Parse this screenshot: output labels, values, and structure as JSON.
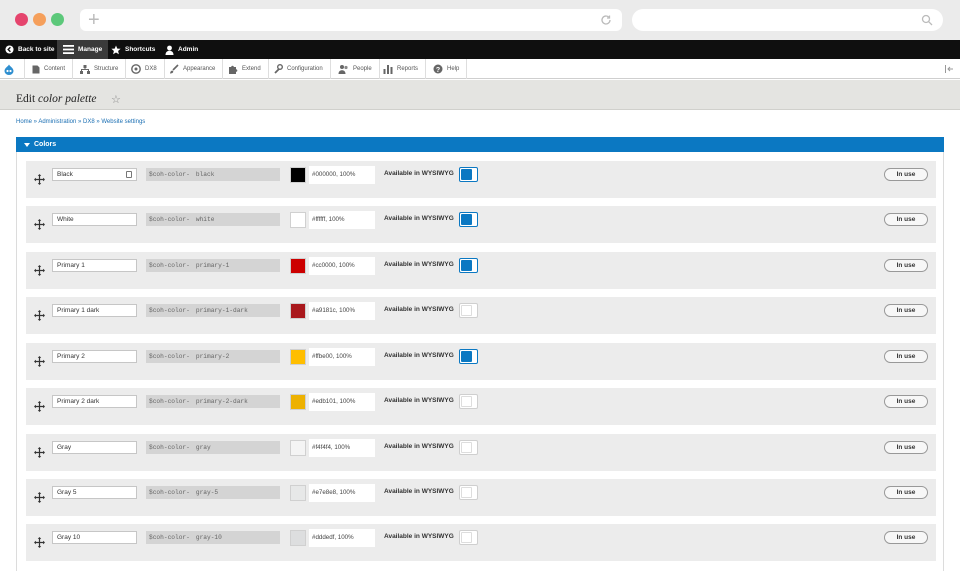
{
  "toolbar": {
    "back_to_site": "Back to site",
    "manage": "Manage",
    "shortcuts": "Shortcuts",
    "admin": "Admin"
  },
  "tray": {
    "items": [
      "Content",
      "Structure",
      "DX8",
      "Appearance",
      "Extend",
      "Configuration",
      "People",
      "Reports",
      "Help"
    ]
  },
  "page": {
    "title_prefix": "Edit",
    "title_italic": "color palette",
    "breadcrumb": "Home » Administration » DX8 » Website settings"
  },
  "colors": {
    "legend": "Colors",
    "prefix": "$coh-color-",
    "wysiwyg_label": "Available in WYSIWYG",
    "in_use_label": "In use",
    "rows": [
      {
        "name": "Black",
        "var": "black",
        "hex": "#000000, 100%",
        "swatch": "#000000",
        "wysiwyg": true
      },
      {
        "name": "White",
        "var": "white",
        "hex": "#ffffff, 100%",
        "swatch": "#ffffff",
        "wysiwyg": true
      },
      {
        "name": "Primary 1",
        "var": "primary-1",
        "hex": "#cc0000, 100%",
        "swatch": "#cc0000",
        "wysiwyg": true
      },
      {
        "name": "Primary 1 dark",
        "var": "primary-1-dark",
        "hex": "#a9181c, 100%",
        "swatch": "#a9181c",
        "wysiwyg": false
      },
      {
        "name": "Primary 2",
        "var": "primary-2",
        "hex": "#ffbe00, 100%",
        "swatch": "#ffbe00",
        "wysiwyg": true
      },
      {
        "name": "Primary 2 dark",
        "var": "primary-2-dark",
        "hex": "#edb101, 100%",
        "swatch": "#edb101",
        "wysiwyg": false
      },
      {
        "name": "Gray",
        "var": "gray",
        "hex": "#f4f4f4, 100%",
        "swatch": "#f4f4f4",
        "wysiwyg": false
      },
      {
        "name": "Gray 5",
        "var": "gray-5",
        "hex": "#e7e8e8, 100%",
        "swatch": "#e7e8e8",
        "wysiwyg": false
      },
      {
        "name": "Gray 10",
        "var": "gray-10",
        "hex": "#dddedf, 100%",
        "swatch": "#dddedf",
        "wysiwyg": false
      }
    ]
  },
  "theme": {
    "accent": "#0b78c2",
    "toolbar_bg": "#0f0f0f"
  }
}
